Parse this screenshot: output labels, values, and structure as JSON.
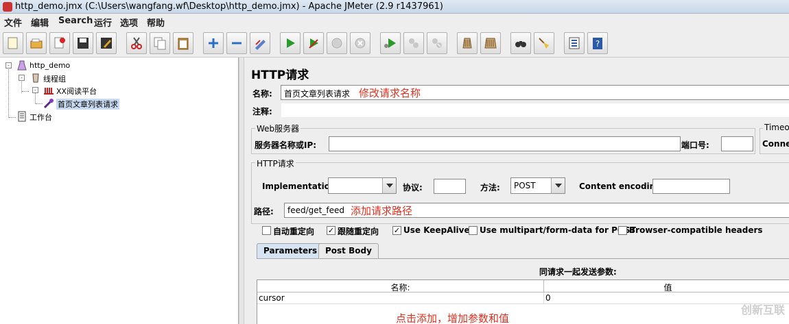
{
  "window": {
    "title": "http_demo.jmx (C:\\Users\\wangfang.wf\\Desktop\\http_demo.jmx) - Apache JMeter (2.9 r1437961)"
  },
  "menu": [
    "文件",
    "编辑",
    "Search",
    "运行",
    "选项",
    "帮助"
  ],
  "toolbar": {
    "buttons": [
      "new-icon",
      "open-icon",
      "close-icon",
      "save-icon",
      "save-as-icon",
      "cut-icon",
      "copy-icon",
      "paste-icon",
      "expand-icon",
      "collapse-icon",
      "toggle-icon",
      "start-icon",
      "start-no-pause-icon",
      "stop-icon",
      "shutdown-icon",
      "remote-start-icon",
      "remote-stop-icon",
      "remote-shutdown-icon",
      "clear-icon",
      "clear-all-icon",
      "search-icon",
      "reset-search-icon",
      "function-helper-icon",
      "help-icon"
    ]
  },
  "tree": {
    "root": "http_demo",
    "thread_group": "线程组",
    "sampler_parent": "XX阅读平台",
    "selected": "首页文章列表请求",
    "workbench": "工作台"
  },
  "panel": {
    "heading": "HTTP请求",
    "name_label": "名称:",
    "name_value": "首页文章列表请求",
    "name_note": "修改请求名称",
    "comment_label": "注释:",
    "web_server_title": "Web服务器",
    "server_label": "服务器名称或IP:",
    "port_label": "端口号:",
    "timeout_title": "Timeo",
    "connect_label": "Connec",
    "http_request_title": "HTTP请求",
    "implementation_label": "Implementation:",
    "protocol_label": "协议:",
    "method_label": "方法:",
    "method_value": "POST",
    "encoding_label": "Content encoding:",
    "path_label": "路径:",
    "path_value": "feed/get_feed",
    "path_note": "添加请求路径",
    "checkboxes": [
      {
        "label": "自动重定向",
        "checked": false
      },
      {
        "label": "跟随重定向",
        "checked": true
      },
      {
        "label": "Use KeepAlive",
        "checked": true
      },
      {
        "label": "Use multipart/form-data for POST",
        "checked": false
      },
      {
        "label": "Browser-compatible headers",
        "checked": false
      }
    ],
    "tabs": [
      "Parameters",
      "Post Body"
    ],
    "params_caption": "同请求一起发送参数:",
    "table_headers": [
      "名称:",
      "值"
    ],
    "table_rows": [
      {
        "name": "cursor",
        "value": "0"
      }
    ],
    "add_note": "点击添加，增加参数和值",
    "watermark": "创新互联"
  }
}
